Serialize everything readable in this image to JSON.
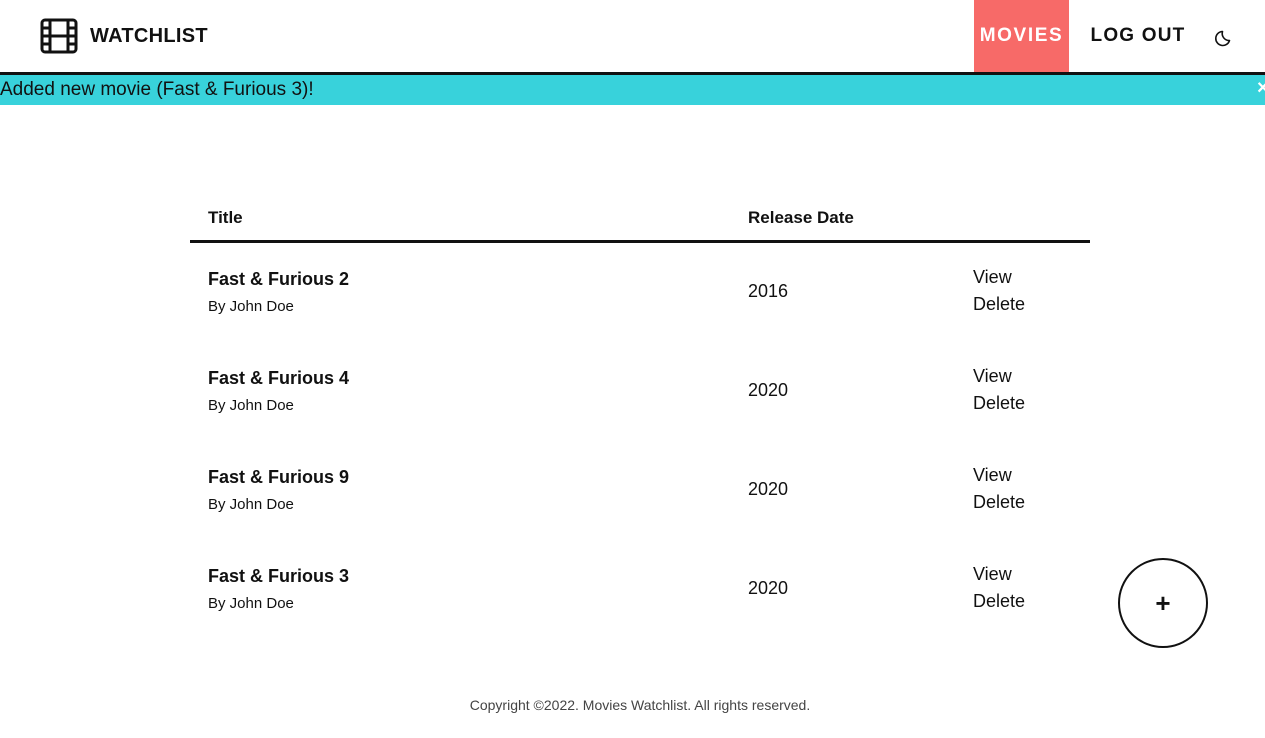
{
  "header": {
    "brand": "WATCHLIST",
    "logo_icon": "film-icon",
    "nav": {
      "movies": "MOVIES",
      "logout": "LOG OUT"
    },
    "theme_icon": "moon-icon"
  },
  "alert": {
    "message": "Added new movie (Fast & Furious 3)!",
    "close": "×",
    "color": "#38d2db"
  },
  "table": {
    "columns": {
      "title": "Title",
      "release_date": "Release Date"
    },
    "rows": [
      {
        "title": "Fast & Furious 2",
        "author": "By John Doe",
        "date": "2016",
        "view": "View",
        "delete": "Delete"
      },
      {
        "title": "Fast & Furious 4",
        "author": "By John Doe",
        "date": "2020",
        "view": "View",
        "delete": "Delete"
      },
      {
        "title": "Fast & Furious 9",
        "author": "By John Doe",
        "date": "2020",
        "view": "View",
        "delete": "Delete"
      },
      {
        "title": "Fast & Furious 3",
        "author": "By John Doe",
        "date": "2020",
        "view": "View",
        "delete": "Delete"
      }
    ]
  },
  "add_button": "+",
  "footer": "Copyright ©2022. Movies Watchlist. All rights reserved.",
  "colors": {
    "accent": "#f76a68",
    "alert": "#38d2db",
    "text": "#111111"
  }
}
